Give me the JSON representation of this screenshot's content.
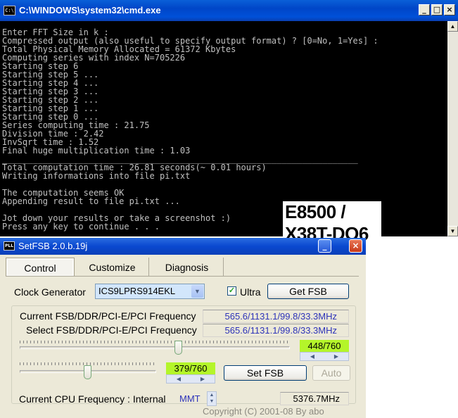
{
  "cmd_window": {
    "title": "C:\\WINDOWS\\system32\\cmd.exe",
    "icon": "cmd-icon",
    "icon_text": "C:\\",
    "controls": {
      "minimize": "_",
      "maximize": "□",
      "close": "×"
    },
    "lines": [
      "Enter FFT Size in k :",
      "Compressed output (also useful to specify output format) ? [0=No, 1=Yes] :",
      "Total Physical Memory Allocated = 61372 Kbytes",
      "Computing series with index N=705226",
      "Starting step 6",
      "Starting step 5 ...",
      "Starting step 4 ...",
      "Starting step 3 ...",
      "Starting step 2 ...",
      "Starting step 1 ...",
      "Starting step 0 ...",
      "Series computing time : 21.75",
      "Division time : 2.42",
      "InvSqrt time : 1.52",
      "Final huge multiplication time : 1.03",
      "______________________________________________________________________",
      "Total computation time : 26.81 seconds(~ 0.01 hours)",
      "Writing informations into file pi.txt",
      "",
      "The computation seems OK",
      "Appending result to file pi.txt ...",
      "",
      "Jot down your results or take a screenshot :)",
      "Press any key to continue . . ."
    ]
  },
  "caption": {
    "line1": "E8500 /",
    "line2": "X38T-DQ6"
  },
  "setfsb_window": {
    "title": "SetFSB 2.0.b.19j",
    "icon_text": "PLL",
    "tabs": [
      {
        "label": "Control",
        "active": true
      },
      {
        "label": "Customize",
        "active": false
      },
      {
        "label": "Diagnosis",
        "active": false
      }
    ],
    "clock_generator_label": "Clock Generator",
    "clock_generator_value": "ICS9LPRS914EKL",
    "ultra_label": "Ultra",
    "ultra_checked": true,
    "get_fsb_label": "Get FSB",
    "current_freq_label": "Current FSB/DDR/PCI-E/PCI Frequency",
    "current_freq_value": "565.6/1131.1/99.8/33.3MHz",
    "select_freq_label": "Select FSB/DDR/PCI-E/PCI Frequency",
    "select_freq_value": "565.6/1131.1/99.8/33.3MHz",
    "slider1": {
      "value_text": "448/760",
      "fraction": 0.589
    },
    "slider2": {
      "value_text": "379/760",
      "fraction": 0.499
    },
    "set_fsb_label": "Set FSB",
    "auto_label": "Auto",
    "cpu_freq_label": "Current CPU Frequency : Internal",
    "cpu_freq_mode": "MMT",
    "cpu_freq_value": "5376.7MHz",
    "copyright": "Copyright (C) 2001-08 By abo"
  }
}
